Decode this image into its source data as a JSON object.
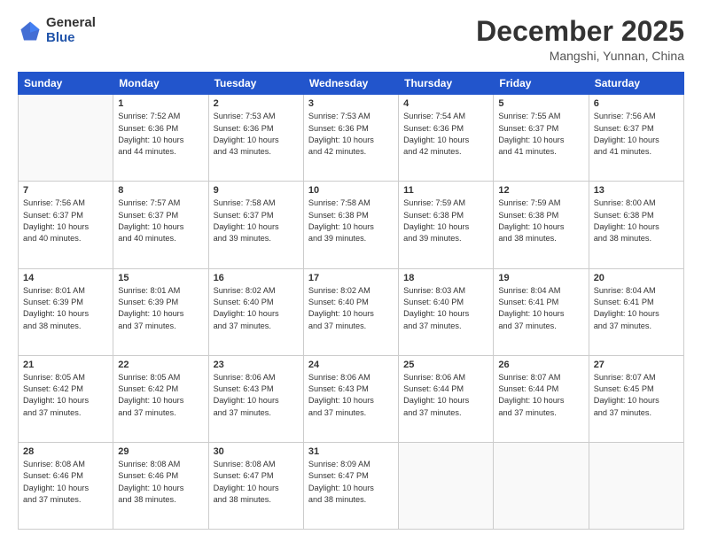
{
  "header": {
    "logo_general": "General",
    "logo_blue": "Blue",
    "month": "December 2025",
    "location": "Mangshi, Yunnan, China"
  },
  "weekdays": [
    "Sunday",
    "Monday",
    "Tuesday",
    "Wednesday",
    "Thursday",
    "Friday",
    "Saturday"
  ],
  "weeks": [
    [
      {
        "day": "",
        "info": ""
      },
      {
        "day": "1",
        "info": "Sunrise: 7:52 AM\nSunset: 6:36 PM\nDaylight: 10 hours\nand 44 minutes."
      },
      {
        "day": "2",
        "info": "Sunrise: 7:53 AM\nSunset: 6:36 PM\nDaylight: 10 hours\nand 43 minutes."
      },
      {
        "day": "3",
        "info": "Sunrise: 7:53 AM\nSunset: 6:36 PM\nDaylight: 10 hours\nand 42 minutes."
      },
      {
        "day": "4",
        "info": "Sunrise: 7:54 AM\nSunset: 6:36 PM\nDaylight: 10 hours\nand 42 minutes."
      },
      {
        "day": "5",
        "info": "Sunrise: 7:55 AM\nSunset: 6:37 PM\nDaylight: 10 hours\nand 41 minutes."
      },
      {
        "day": "6",
        "info": "Sunrise: 7:56 AM\nSunset: 6:37 PM\nDaylight: 10 hours\nand 41 minutes."
      }
    ],
    [
      {
        "day": "7",
        "info": "Sunrise: 7:56 AM\nSunset: 6:37 PM\nDaylight: 10 hours\nand 40 minutes."
      },
      {
        "day": "8",
        "info": "Sunrise: 7:57 AM\nSunset: 6:37 PM\nDaylight: 10 hours\nand 40 minutes."
      },
      {
        "day": "9",
        "info": "Sunrise: 7:58 AM\nSunset: 6:37 PM\nDaylight: 10 hours\nand 39 minutes."
      },
      {
        "day": "10",
        "info": "Sunrise: 7:58 AM\nSunset: 6:38 PM\nDaylight: 10 hours\nand 39 minutes."
      },
      {
        "day": "11",
        "info": "Sunrise: 7:59 AM\nSunset: 6:38 PM\nDaylight: 10 hours\nand 39 minutes."
      },
      {
        "day": "12",
        "info": "Sunrise: 7:59 AM\nSunset: 6:38 PM\nDaylight: 10 hours\nand 38 minutes."
      },
      {
        "day": "13",
        "info": "Sunrise: 8:00 AM\nSunset: 6:38 PM\nDaylight: 10 hours\nand 38 minutes."
      }
    ],
    [
      {
        "day": "14",
        "info": "Sunrise: 8:01 AM\nSunset: 6:39 PM\nDaylight: 10 hours\nand 38 minutes."
      },
      {
        "day": "15",
        "info": "Sunrise: 8:01 AM\nSunset: 6:39 PM\nDaylight: 10 hours\nand 37 minutes."
      },
      {
        "day": "16",
        "info": "Sunrise: 8:02 AM\nSunset: 6:40 PM\nDaylight: 10 hours\nand 37 minutes."
      },
      {
        "day": "17",
        "info": "Sunrise: 8:02 AM\nSunset: 6:40 PM\nDaylight: 10 hours\nand 37 minutes."
      },
      {
        "day": "18",
        "info": "Sunrise: 8:03 AM\nSunset: 6:40 PM\nDaylight: 10 hours\nand 37 minutes."
      },
      {
        "day": "19",
        "info": "Sunrise: 8:04 AM\nSunset: 6:41 PM\nDaylight: 10 hours\nand 37 minutes."
      },
      {
        "day": "20",
        "info": "Sunrise: 8:04 AM\nSunset: 6:41 PM\nDaylight: 10 hours\nand 37 minutes."
      }
    ],
    [
      {
        "day": "21",
        "info": "Sunrise: 8:05 AM\nSunset: 6:42 PM\nDaylight: 10 hours\nand 37 minutes."
      },
      {
        "day": "22",
        "info": "Sunrise: 8:05 AM\nSunset: 6:42 PM\nDaylight: 10 hours\nand 37 minutes."
      },
      {
        "day": "23",
        "info": "Sunrise: 8:06 AM\nSunset: 6:43 PM\nDaylight: 10 hours\nand 37 minutes."
      },
      {
        "day": "24",
        "info": "Sunrise: 8:06 AM\nSunset: 6:43 PM\nDaylight: 10 hours\nand 37 minutes."
      },
      {
        "day": "25",
        "info": "Sunrise: 8:06 AM\nSunset: 6:44 PM\nDaylight: 10 hours\nand 37 minutes."
      },
      {
        "day": "26",
        "info": "Sunrise: 8:07 AM\nSunset: 6:44 PM\nDaylight: 10 hours\nand 37 minutes."
      },
      {
        "day": "27",
        "info": "Sunrise: 8:07 AM\nSunset: 6:45 PM\nDaylight: 10 hours\nand 37 minutes."
      }
    ],
    [
      {
        "day": "28",
        "info": "Sunrise: 8:08 AM\nSunset: 6:46 PM\nDaylight: 10 hours\nand 37 minutes."
      },
      {
        "day": "29",
        "info": "Sunrise: 8:08 AM\nSunset: 6:46 PM\nDaylight: 10 hours\nand 38 minutes."
      },
      {
        "day": "30",
        "info": "Sunrise: 8:08 AM\nSunset: 6:47 PM\nDaylight: 10 hours\nand 38 minutes."
      },
      {
        "day": "31",
        "info": "Sunrise: 8:09 AM\nSunset: 6:47 PM\nDaylight: 10 hours\nand 38 minutes."
      },
      {
        "day": "",
        "info": ""
      },
      {
        "day": "",
        "info": ""
      },
      {
        "day": "",
        "info": ""
      }
    ]
  ]
}
